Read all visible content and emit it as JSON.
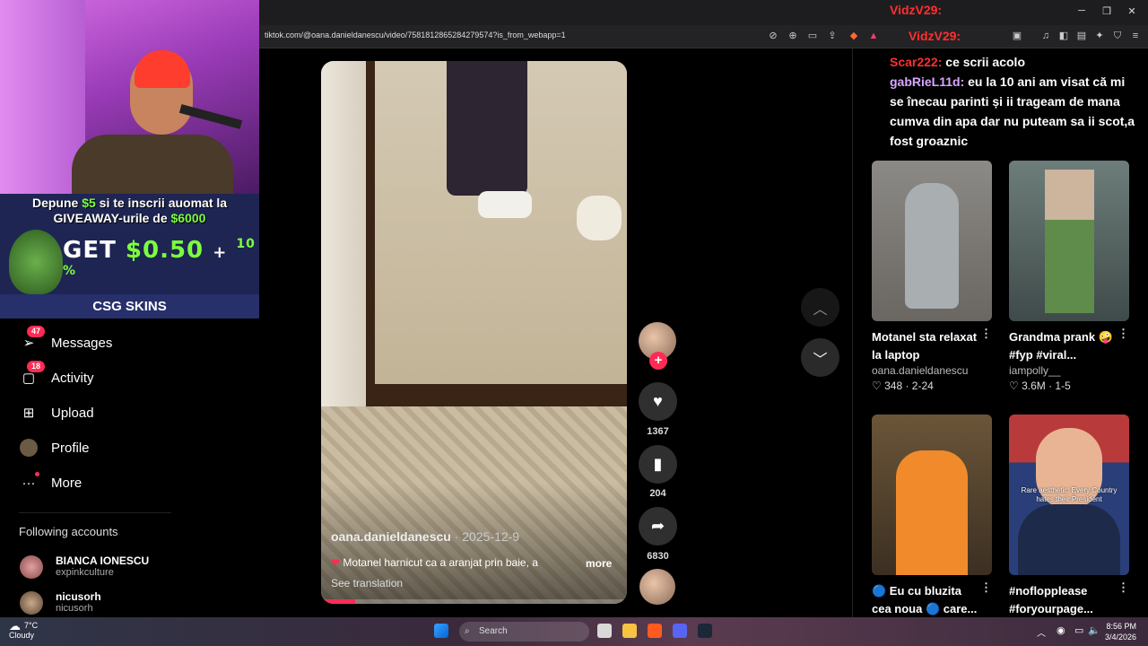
{
  "browser": {
    "url": "tiktok.com/@oana.danieldanescu/video/7581812865284279574?is_from_webapp=1"
  },
  "stream": {
    "promo_line1_prefix": "Depune",
    "promo_amount": "$5",
    "promo_line1_suffix": "si te inscrii auomat la",
    "promo_line2_prefix": "GIVEAWAY-urile de",
    "promo_amount2": "$6000",
    "promo_get": "GET",
    "promo_get_amount": "$0.50",
    "promo_plus": "+",
    "promo_percent": "10 %",
    "promo_brand": "CSG SKINS"
  },
  "sidebar": {
    "items": [
      {
        "label": "Messages",
        "icon": "send-icon",
        "badge": "47"
      },
      {
        "label": "Activity",
        "icon": "inbox-icon",
        "badge": "18"
      },
      {
        "label": "Upload",
        "icon": "plus-square-icon",
        "badge": ""
      },
      {
        "label": "Profile",
        "icon": "avatar-icon",
        "badge": ""
      },
      {
        "label": "More",
        "icon": "ellipsis-icon",
        "badge": ""
      }
    ],
    "following_title": "Following accounts",
    "following": [
      {
        "name": "BIANCA IONESCU",
        "handle": "expinkculture"
      },
      {
        "name": "nicusorh",
        "handle": "nicusorh"
      }
    ]
  },
  "video": {
    "username": "oana.danieldanescu",
    "date": " · 2025-12-9",
    "description": "Motanel harnicut ca a aranjat prin baie, a",
    "more": "more",
    "translation": "See translation",
    "likes": "1367",
    "saves": "204",
    "shares": "6830",
    "progress": 0.11
  },
  "chat": [
    {
      "name": "Scar222:",
      "text": "ce scrii acolo"
    },
    {
      "name": "gabRieL11d:",
      "text": "eu la 10 ani am visat că mi se înecau parinti și ii trageam de mana cumva din apa dar nu puteam sa ii scot,a fost groaznic"
    }
  ],
  "chat_top": {
    "name1": "VidzV29:",
    "name2": "VidzV29:"
  },
  "recommendations": [
    {
      "title": "Motanel sta relaxat la laptop",
      "user": "oana.danieldanescu",
      "stats": "♡ 348 · 2-24"
    },
    {
      "title": "Grandma prank 🤪 #fyp #viral...",
      "user": "iampolly__",
      "stats": "♡ 3.6M · 1-5"
    },
    {
      "title": "🔵 Eu cu bluzita cea noua 🔵 care...",
      "user": "",
      "stats": ""
    },
    {
      "title": "#noflopplease #foryourpage...",
      "user": "",
      "stats": "",
      "overlay": "Rare aesthetic: Every Country hates their President"
    }
  ],
  "taskbar": {
    "temp": "7°C",
    "weather": "Cloudy",
    "search": "Search",
    "time": "8:56 PM",
    "date": "3/4/2026"
  }
}
